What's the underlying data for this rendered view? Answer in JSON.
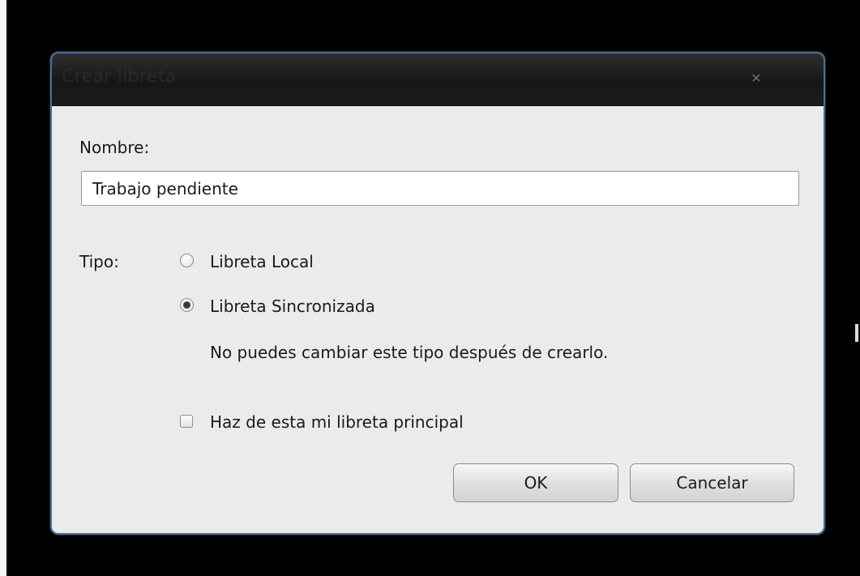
{
  "dialog": {
    "title": "Crear libreta",
    "close_glyph": "✕",
    "close_icon": "close-icon"
  },
  "form": {
    "name_label": "Nombre:",
    "name_value": "Trabajo pendiente",
    "type_label": "Tipo:",
    "type_options": [
      {
        "label": "Libreta Local",
        "selected": false
      },
      {
        "label": "Libreta Sincronizada",
        "selected": true
      }
    ],
    "type_note": "No puedes cambiar este tipo después de crearlo.",
    "default_checkbox_label": "Haz de esta mi libreta principal",
    "default_checked": false
  },
  "buttons": {
    "ok_label": "OK",
    "cancel_label": "Cancelar"
  },
  "colors": {
    "titlebar": "#1b1b1b",
    "dialog_background": "#ebebeb",
    "dialog_border": "#4a6c93"
  }
}
